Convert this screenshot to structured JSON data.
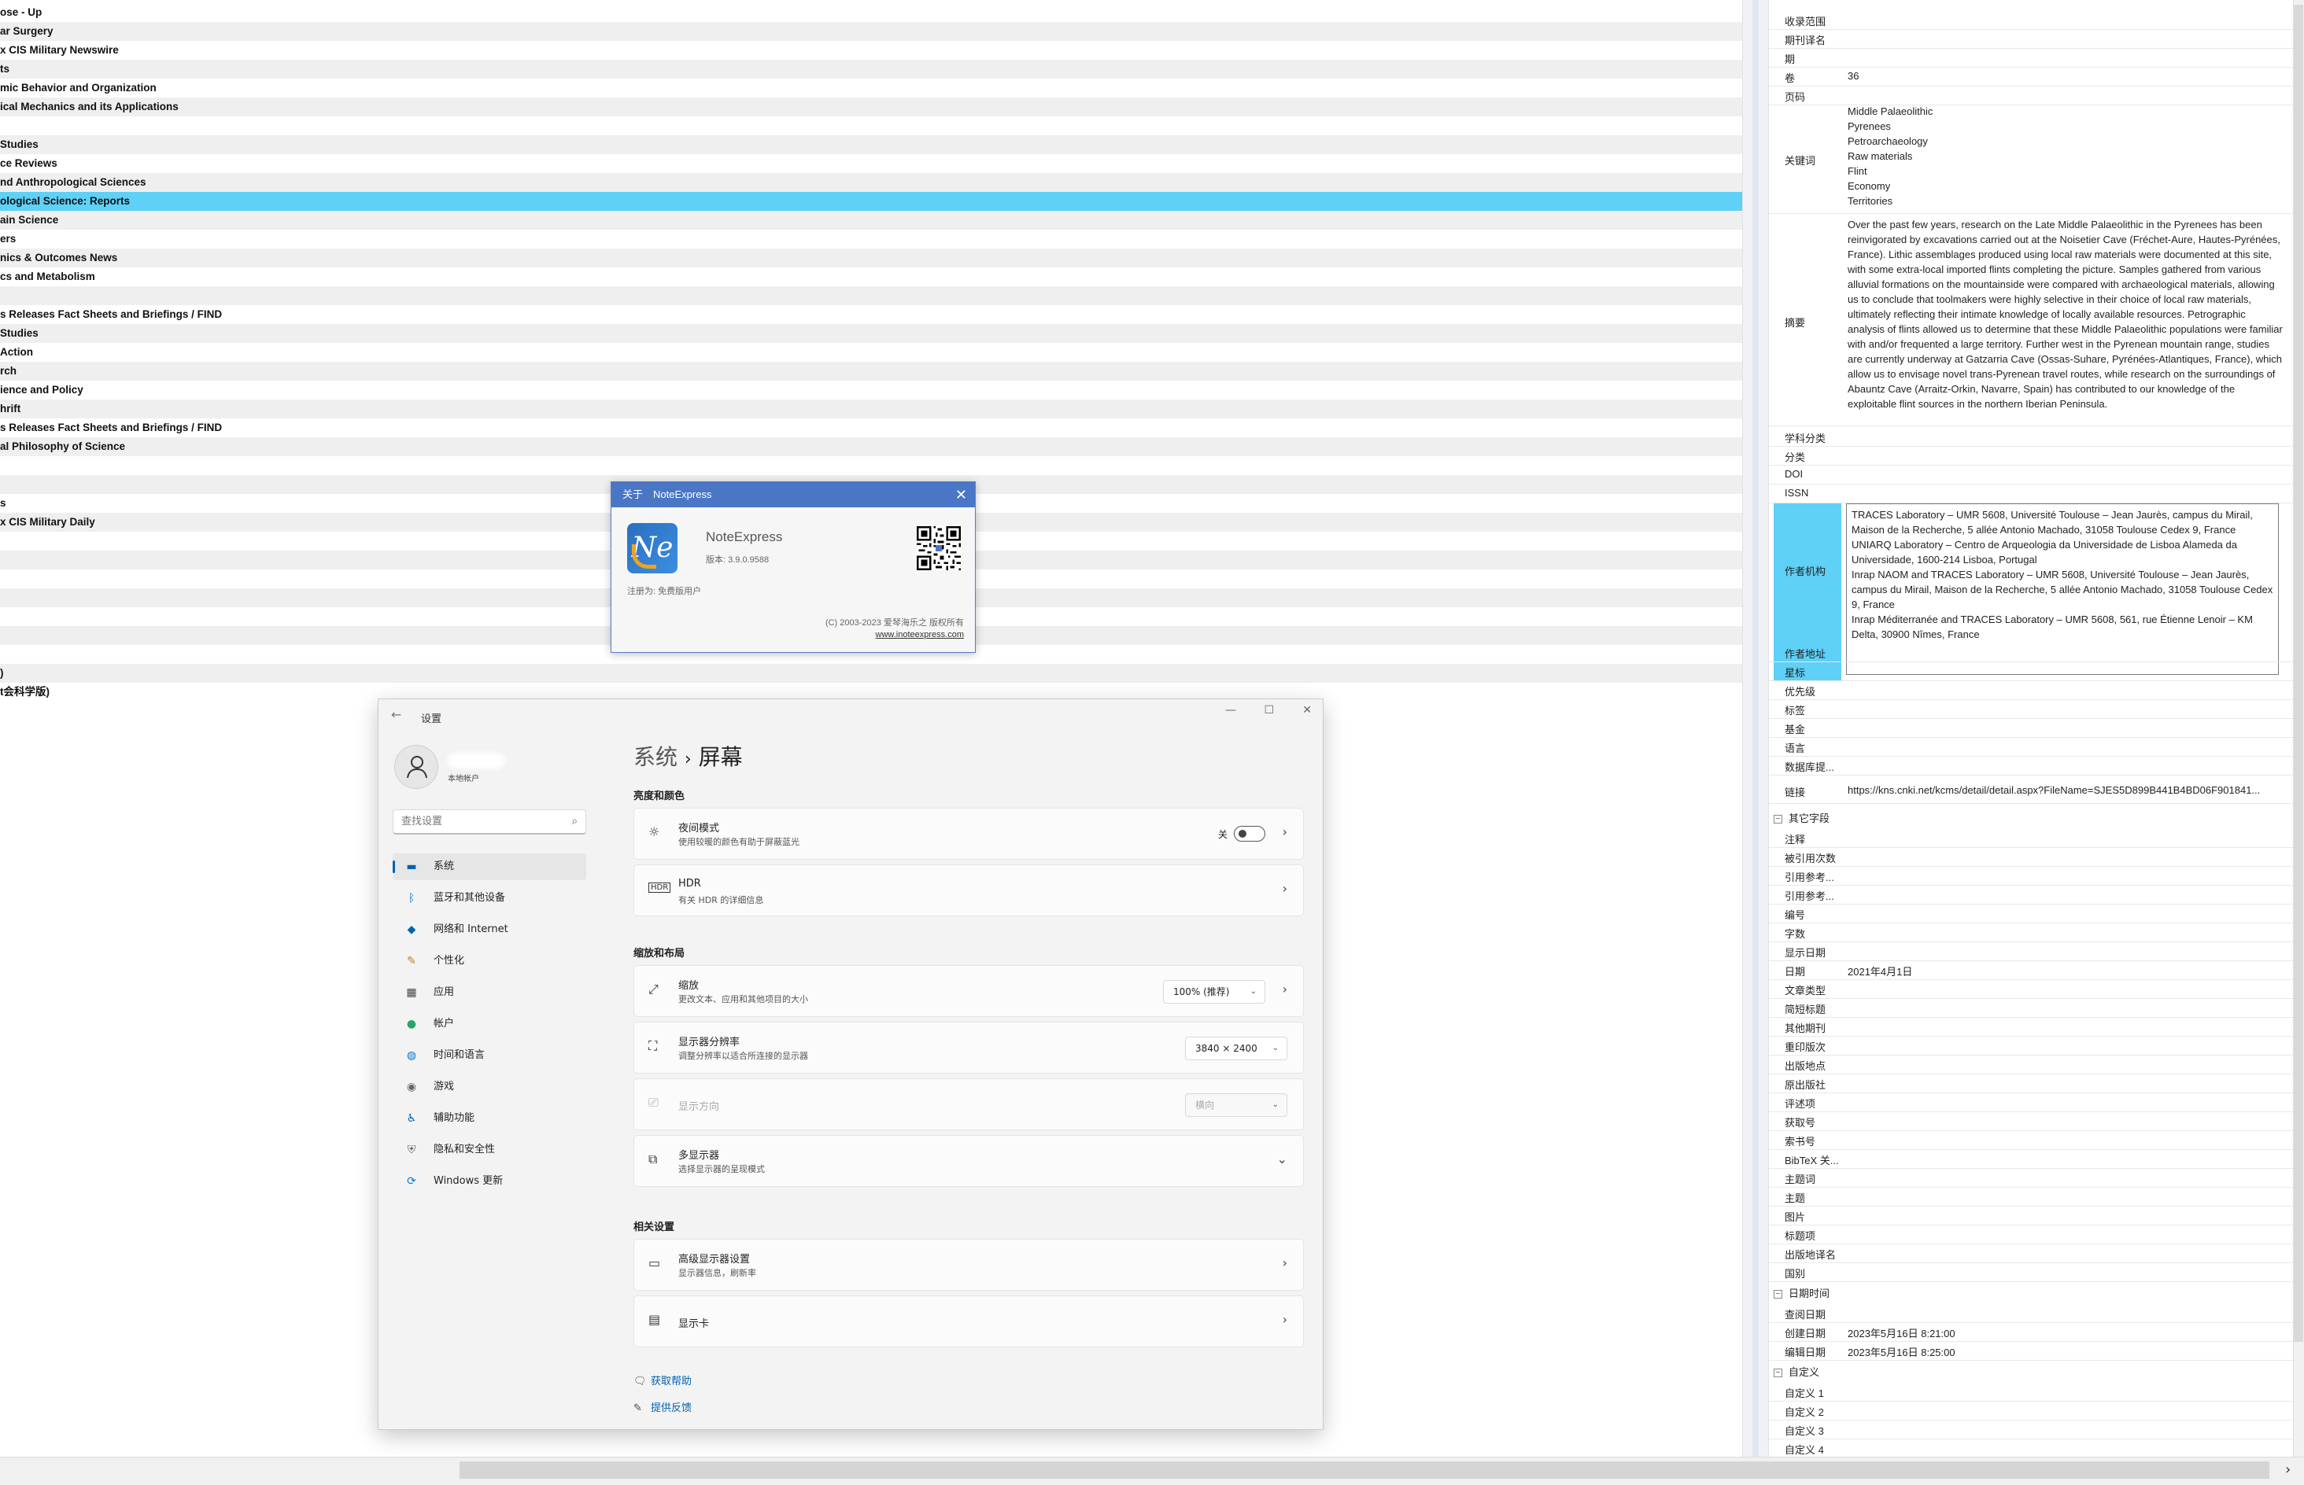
{
  "journal_list": {
    "selected_index": 10,
    "rows": [
      "ose - Up",
      "ar Surgery",
      "x CIS Military Newswire",
      "ts",
      "mic Behavior and Organization",
      "ical Mechanics and its Applications",
      "",
      "Studies",
      "ce Reviews",
      "nd Anthropological Sciences",
      "ological Science: Reports",
      "ain Science",
      "ers",
      "nics & Outcomes News",
      "cs and Metabolism",
      "",
      "s Releases Fact Sheets and Briefings / FIND",
      "Studies",
      "Action",
      "rch",
      "ience and Policy",
      "hrift",
      "s Releases Fact Sheets and Briefings / FIND",
      "al Philosophy of Science",
      "",
      "",
      "s",
      "x CIS Military Daily",
      "",
      "",
      "",
      "",
      "",
      "",
      "",
      ")",
      "t会科学版)"
    ]
  },
  "properties": {
    "top_rows": [
      {
        "label": "收录范围",
        "value": ""
      },
      {
        "label": "期刊译名",
        "value": ""
      },
      {
        "label": "期",
        "value": ""
      },
      {
        "label": "卷",
        "value": "36"
      },
      {
        "label": "页码",
        "value": ""
      }
    ],
    "keywords_label": "关键词",
    "keywords": [
      "Middle Palaeolithic",
      "Pyrenees",
      "Petroarchaeology",
      "Raw materials",
      "Flint",
      "Economy",
      "Territories"
    ],
    "abstract_label": "摘要",
    "abstract": "Over the past few years, research on the Late Middle Palaeolithic in the Pyrenees has been reinvigorated by excavations carried out at the Noisetier Cave (Fréchet-Aure, Hautes-Pyrénées, France). Lithic assemblages produced using local raw materials were documented at this site, with some extra-local imported flints completing the picture. Samples gathered from various alluvial formations on the mountainside were compared with archaeological materials, allowing us to conclude that toolmakers were highly selective in their choice of local raw materials, ultimately reflecting their intimate knowledge of locally available resources. Petrographic analysis of flints allowed us to determine that these Middle Palaeolithic populations were familiar with and/or frequented a large territory. Further west in the Pyrenean mountain range, studies are currently underway at Gatzarria Cave (Ossas-Suhare, Pyrénées-Atlantiques, France), which allow us to envisage novel trans-Pyrenean travel routes, while research on the surroundings of Abauntz Cave (Arraitz-Orkin, Navarre, Spain) has contributed to our knowledge of the exploitable flint sources in the northern Iberian Peninsula.",
    "mid_rows": [
      {
        "label": "学科分类",
        "value": ""
      },
      {
        "label": "分类",
        "value": ""
      },
      {
        "label": "DOI",
        "value": ""
      },
      {
        "label": "ISSN",
        "value": ""
      }
    ],
    "affil_label": "作者机构",
    "affiliations": "TRACES Laboratory – UMR 5608, Université Toulouse – Jean Jaurès, campus du Mirail, Maison de la Recherche, 5 allée Antonio Machado, 31058 Toulouse Cedex 9, France\nUNIARQ Laboratory – Centro de Arqueologia da Universidade de Lisboa Alameda da Universidade, 1600-214 Lisboa, Portugal\nInrap NAOM and TRACES Laboratory – UMR 5608, Université Toulouse – Jean Jaurès, campus du Mirail, Maison de la Recherche, 5 allée Antonio Machado, 31058 Toulouse Cedex 9, France\nInrap Méditerranée and TRACES Laboratory – UMR 5608, 561, rue Étienne Lenoir – KM Delta, 30900 Nîmes, France",
    "after_rows": [
      {
        "label": "作者地址",
        "value": ""
      },
      {
        "label": "星标",
        "value": ""
      },
      {
        "label": "优先级",
        "value": ""
      },
      {
        "label": "标签",
        "value": ""
      },
      {
        "label": "基金",
        "value": ""
      },
      {
        "label": "语言",
        "value": ""
      },
      {
        "label": "数据库提...",
        "value": ""
      }
    ],
    "link_label": "链接",
    "link_value": "https://kns.cnki.net/kcms/detail/detail.aspx?FileName=SJES5D899B441B4BD06F901841...",
    "section_other": "其它字段",
    "other_rows": [
      {
        "label": "注释",
        "value": ""
      },
      {
        "label": "被引用次数",
        "value": ""
      },
      {
        "label": "引用参考...",
        "value": ""
      },
      {
        "label": "引用参考...",
        "value": ""
      },
      {
        "label": "编号",
        "value": ""
      },
      {
        "label": "字数",
        "value": ""
      },
      {
        "label": "显示日期",
        "value": ""
      },
      {
        "label": "日期",
        "value": "2021年4月1日"
      },
      {
        "label": "文章类型",
        "value": ""
      },
      {
        "label": "简短标题",
        "value": ""
      },
      {
        "label": "其他期刊",
        "value": ""
      },
      {
        "label": "重印版次",
        "value": ""
      },
      {
        "label": "出版地点",
        "value": ""
      },
      {
        "label": "原出版社",
        "value": ""
      },
      {
        "label": "评述项",
        "value": ""
      },
      {
        "label": "获取号",
        "value": ""
      },
      {
        "label": "索书号",
        "value": ""
      },
      {
        "label": "BibTeX 关...",
        "value": ""
      },
      {
        "label": "主题词",
        "value": ""
      },
      {
        "label": "主题",
        "value": ""
      },
      {
        "label": "图片",
        "value": ""
      },
      {
        "label": "标题项",
        "value": ""
      },
      {
        "label": "出版地译名",
        "value": ""
      },
      {
        "label": "国别",
        "value": ""
      }
    ],
    "section_date": "日期时间",
    "date_rows": [
      {
        "label": "查阅日期",
        "value": ""
      },
      {
        "label": "创建日期",
        "value": "2023年5月16日 8:21:00"
      },
      {
        "label": "编辑日期",
        "value": "2023年5月16日 8:25:00"
      }
    ],
    "section_custom": "自定义",
    "custom_rows": [
      {
        "label": "自定义 1",
        "value": ""
      },
      {
        "label": "自定义 2",
        "value": ""
      },
      {
        "label": "自定义 3",
        "value": ""
      },
      {
        "label": "自定义 4",
        "value": ""
      }
    ]
  },
  "about": {
    "title": "关于　NoteExpress",
    "logo_text": "Ne",
    "app_name": "NoteExpress",
    "version": "版本: 3.9.0.9588",
    "registered": "注册为: 免费版用户",
    "copyright": "(C) 2003-2023 爱琴海乐之 版权所有",
    "url": "www.inoteexpress.com"
  },
  "settings": {
    "window_title": "设置",
    "user_label": "本地帐户",
    "search_placeholder": "查找设置",
    "nav": [
      {
        "label": "系统",
        "icon": "display-icon"
      },
      {
        "label": "蓝牙和其他设备",
        "icon": "bluetooth-icon"
      },
      {
        "label": "网络和 Internet",
        "icon": "wifi-icon"
      },
      {
        "label": "个性化",
        "icon": "brush-icon"
      },
      {
        "label": "应用",
        "icon": "apps-icon"
      },
      {
        "label": "帐户",
        "icon": "person-icon"
      },
      {
        "label": "时间和语言",
        "icon": "globe-icon"
      },
      {
        "label": "游戏",
        "icon": "gamepad-icon"
      },
      {
        "label": "辅助功能",
        "icon": "accessibility-icon"
      },
      {
        "label": "隐私和安全性",
        "icon": "shield-icon"
      },
      {
        "label": "Windows 更新",
        "icon": "update-icon"
      }
    ],
    "breadcrumb_parent": "系统",
    "breadcrumb_sep": "›",
    "breadcrumb_current": "屏幕",
    "section_brightness": "亮度和颜色",
    "night_title": "夜间模式",
    "night_sub": "使用较暖的颜色有助于屏蔽蓝光",
    "night_state": "关",
    "hdr_title": "HDR",
    "hdr_sub": "有关 HDR 的详细信息",
    "section_scale": "缩放和布局",
    "scale_title": "缩放",
    "scale_sub": "更改文本、应用和其他项目的大小",
    "scale_value": "100% (推荐)",
    "res_title": "显示器分辨率",
    "res_sub": "调整分辨率以适合所连接的显示器",
    "res_value": "3840 × 2400",
    "orient_title": "显示方向",
    "orient_value": "横向",
    "multi_title": "多显示器",
    "multi_sub": "选择显示器的呈现模式",
    "section_related": "相关设置",
    "adv_title": "高级显示器设置",
    "adv_sub": "显示器信息，刷新率",
    "gpu_title": "显示卡",
    "help": "获取帮助",
    "feedback": "提供反馈"
  }
}
